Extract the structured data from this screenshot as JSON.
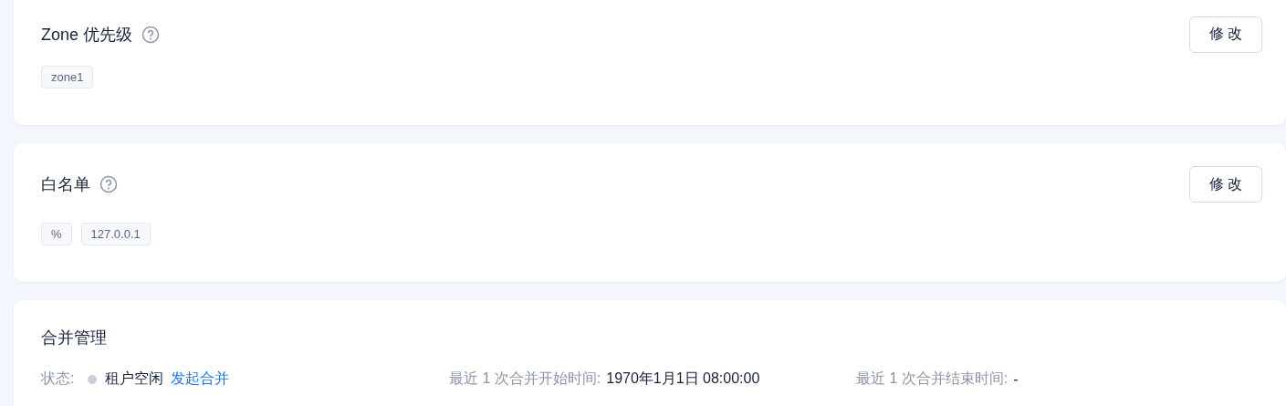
{
  "sections": [
    {
      "title": "Zone 优先级",
      "help": true,
      "button": "修 改",
      "tags": [
        "zone1"
      ]
    },
    {
      "title": "白名单",
      "help": true,
      "button": "修 改",
      "tags": [
        "%",
        "127.0.0.1"
      ]
    }
  ],
  "merge": {
    "title": "合并管理",
    "status": {
      "label": "状态:",
      "text": "租户空闲",
      "color": "#c9d0dd",
      "link": "发起合并"
    },
    "fields": [
      {
        "label": "最近 1 次合并开始时间:",
        "value": "1970年1月1日 08:00:00"
      },
      {
        "label": "最近 1 次合并结束时间:",
        "value": "-"
      }
    ]
  }
}
